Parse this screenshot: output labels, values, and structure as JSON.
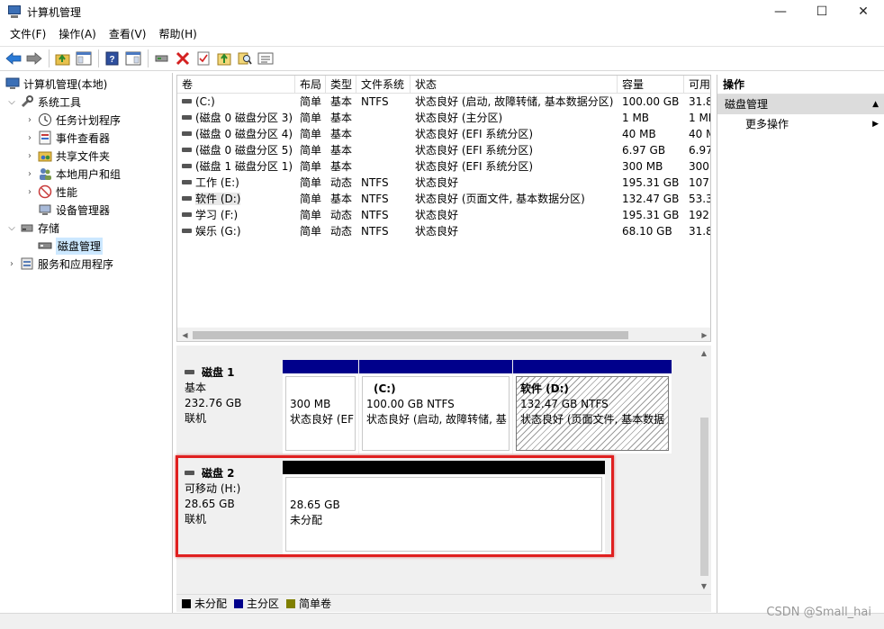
{
  "window": {
    "title": "计算机管理",
    "min": "—",
    "max": "☐",
    "close": "✕"
  },
  "menu": [
    "文件(F)",
    "操作(A)",
    "查看(V)",
    "帮助(H)"
  ],
  "tree": {
    "root": "计算机管理(本地)",
    "system_tools": "系统工具",
    "task_scheduler": "任务计划程序",
    "event_viewer": "事件查看器",
    "shared_folders": "共享文件夹",
    "local_users": "本地用户和组",
    "performance": "性能",
    "device_manager": "设备管理器",
    "storage": "存储",
    "disk_management": "磁盘管理",
    "services_apps": "服务和应用程序"
  },
  "list": {
    "headers": [
      "卷",
      "布局",
      "类型",
      "文件系统",
      "状态",
      "容量",
      "可用"
    ],
    "rows": [
      [
        "(C:)",
        "简单",
        "基本",
        "NTFS",
        "状态良好 (启动, 故障转储, 基本数据分区)",
        "100.00 GB",
        "31.8"
      ],
      [
        "(磁盘 0 磁盘分区 3)",
        "简单",
        "基本",
        "",
        "状态良好 (主分区)",
        "1 MB",
        "1 MI"
      ],
      [
        "(磁盘 0 磁盘分区 4)",
        "简单",
        "基本",
        "",
        "状态良好 (EFI 系统分区)",
        "40 MB",
        "40 M"
      ],
      [
        "(磁盘 0 磁盘分区 5)",
        "简单",
        "基本",
        "",
        "状态良好 (EFI 系统分区)",
        "6.97 GB",
        "6.97"
      ],
      [
        "(磁盘 1 磁盘分区 1)",
        "简单",
        "基本",
        "",
        "状态良好 (EFI 系统分区)",
        "300 MB",
        "300"
      ],
      [
        "工作 (E:)",
        "简单",
        "动态",
        "NTFS",
        "状态良好",
        "195.31 GB",
        "107."
      ],
      [
        "软件 (D:)",
        "简单",
        "基本",
        "NTFS",
        "状态良好 (页面文件, 基本数据分区)",
        "132.47 GB",
        "53.3"
      ],
      [
        "学习 (F:)",
        "简单",
        "动态",
        "NTFS",
        "状态良好",
        "195.31 GB",
        "192."
      ],
      [
        "娱乐 (G:)",
        "简单",
        "动态",
        "NTFS",
        "状态良好",
        "68.10 GB",
        "31.8"
      ]
    ]
  },
  "disk1": {
    "name": "磁盘 1",
    "type": "基本",
    "size": "232.76 GB",
    "status": "联机",
    "p1_size": "300 MB",
    "p1_status": "状态良好 (EF",
    "p2_name": "(C:)",
    "p2_size": "100.00 GB NTFS",
    "p2_status": "状态良好 (启动, 故障转储, 基",
    "p3_name": "软件  (D:)",
    "p3_size": "132.47 GB NTFS",
    "p3_status": "状态良好 (页面文件, 基本数据"
  },
  "disk2": {
    "name": "磁盘 2",
    "type": "可移动 (H:)",
    "size": "28.65 GB",
    "status": "联机",
    "p1_size": "28.65 GB",
    "p1_status": "未分配"
  },
  "legend": [
    "未分配",
    "主分区",
    "简单卷"
  ],
  "actions": {
    "header": "操作",
    "section": "磁盘管理",
    "more": "更多操作"
  },
  "watermark": "CSDN @Small_hai",
  "colors": {
    "primary_partition": "#00008b",
    "unallocated": "#000000",
    "simple_volume": "#808000",
    "highlight": "#e02020"
  }
}
